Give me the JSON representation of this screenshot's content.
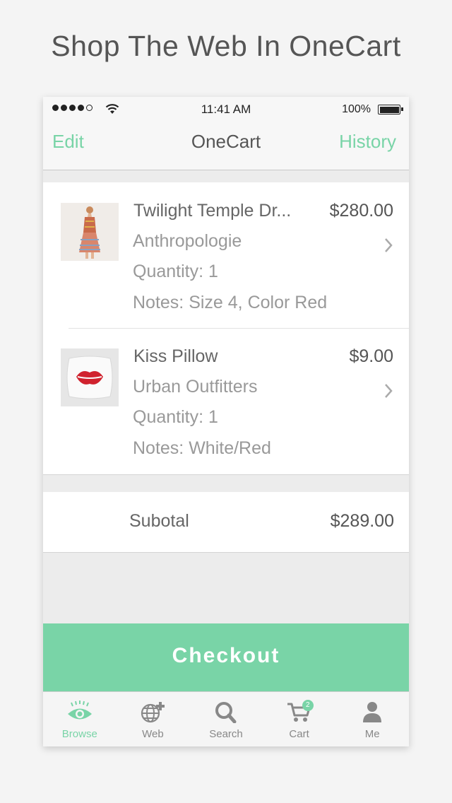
{
  "headline": "Shop The Web In OneCart",
  "status_bar": {
    "time": "11:41 AM",
    "battery": "100%"
  },
  "nav": {
    "left": "Edit",
    "title": "OneCart",
    "right": "History"
  },
  "items": [
    {
      "title": "Twilight Temple Dr...",
      "price": "$280.00",
      "store": "Anthropologie",
      "quantity": "Quantity: 1",
      "notes": "Notes: Size 4, Color Red"
    },
    {
      "title": "Kiss Pillow",
      "price": "$9.00",
      "store": "Urban Outfitters",
      "quantity": "Quantity: 1",
      "notes": "Notes: White/Red"
    }
  ],
  "subtotal": {
    "label": "Subotal",
    "value": "$289.00"
  },
  "checkout_label": "Checkout",
  "tabs": [
    {
      "label": "Browse",
      "icon": "eye-icon",
      "active": true
    },
    {
      "label": "Web",
      "icon": "globe-plus-icon"
    },
    {
      "label": "Search",
      "icon": "magnifier-icon"
    },
    {
      "label": "Cart",
      "icon": "cart-icon",
      "badge": "2"
    },
    {
      "label": "Me",
      "icon": "person-icon"
    }
  ],
  "colors": {
    "accent": "#79d4a7",
    "background": "#f4f4f4"
  }
}
